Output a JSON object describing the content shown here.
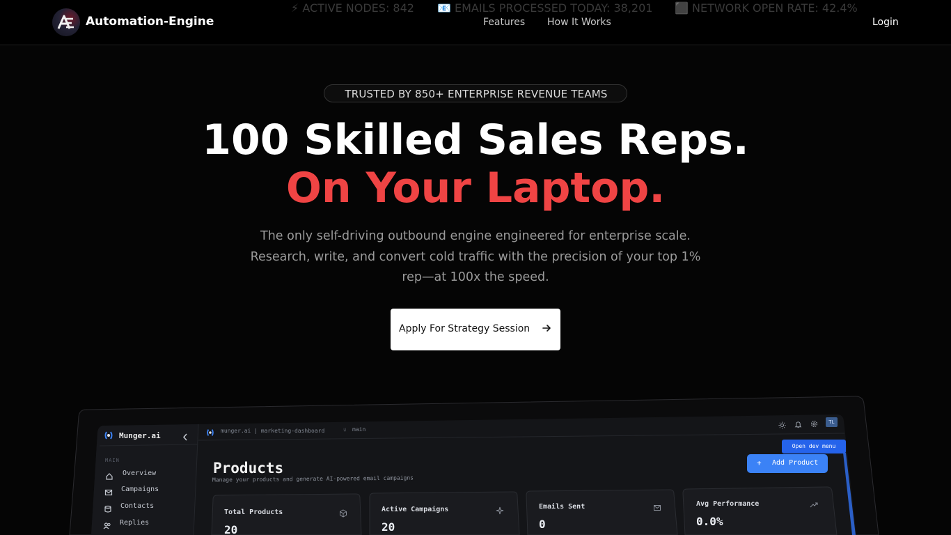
{
  "nav": {
    "brand": "Automation-Engine",
    "logo_letters": "AE",
    "links": [
      "Features",
      "How It Works"
    ],
    "login_label": "Login",
    "ticker": [
      "⚡ ACTIVE NODES: 842",
      "📧 EMAILS PROCESSED TODAY: 38,201",
      "⬛ NETWORK OPEN RATE: 42.4%"
    ]
  },
  "hero": {
    "badge": "TRUSTED BY 850+ ENTERPRISE REVENUE TEAMS",
    "headline_line1": "100 Skilled Sales Reps.",
    "headline_line2": "On Your Laptop.",
    "subtitle_lines": [
      "The only self-driving outbound engine engineered for enterprise scale.",
      "Research, write, and convert cold traffic with the precision of your top 1%",
      "rep—at 100x the speed."
    ],
    "cta_label": "Apply For Strategy Session",
    "cta_icon": "arrow-right-icon"
  },
  "dashboard": {
    "sidebar": {
      "brand": "Munger.ai",
      "collapse_icon": "chevron-left-icon",
      "section": "MAIN",
      "items": [
        {
          "label": "Overview",
          "icon": "home-icon"
        },
        {
          "label": "Campaigns",
          "icon": "mail-icon"
        },
        {
          "label": "Contacts",
          "icon": "database-icon"
        },
        {
          "label": "Replies",
          "icon": "users-icon"
        }
      ]
    },
    "topbar": {
      "breadcrumb": "munger.ai | marketing-dashboard",
      "branch": "main",
      "avatar": "TL",
      "icons": [
        "sun-icon",
        "bell-icon",
        "gear-icon"
      ]
    },
    "page": {
      "title": "Products",
      "subtitle": "Manage your products and generate AI-powered email campaigns",
      "dev_menu_label": "Open dev menu",
      "add_button_label": "Add Product"
    },
    "stats": [
      {
        "label": "Total Products",
        "value": "20",
        "icon": "cube-icon"
      },
      {
        "label": "Active Campaigns",
        "value": "20",
        "icon": "sparkle-icon"
      },
      {
        "label": "Emails Sent",
        "value": "0",
        "icon": "mail-icon"
      },
      {
        "label": "Avg Performance",
        "value": "0.0%",
        "icon": "trend-up-icon"
      }
    ]
  },
  "colors": {
    "background": "#050505",
    "accent_red": "#ef4444",
    "accent_blue": "#3b82f6",
    "dev_menu_blue": "#2563eb"
  }
}
